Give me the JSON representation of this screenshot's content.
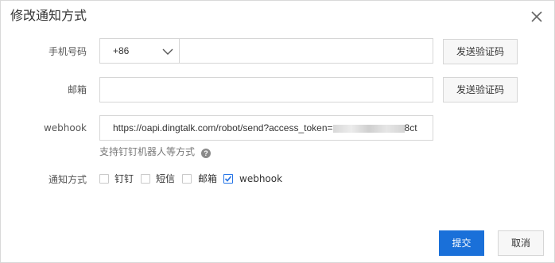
{
  "dialog": {
    "title": "修改通知方式",
    "close_icon": "close-icon"
  },
  "form": {
    "phone": {
      "label": "手机号码",
      "country_code": "+86",
      "value": "",
      "send_code_label": "发送验证码"
    },
    "email": {
      "label": "邮箱",
      "value": "",
      "send_code_label": "发送验证码"
    },
    "webhook": {
      "label": "webhook",
      "value_prefix": "https://oapi.dingtalk.com/robot/send?access_token=",
      "value_suffix": "8ct",
      "hint": "支持钉钉机器人等方式",
      "help_icon": "question-icon"
    },
    "notify_method": {
      "label": "通知方式",
      "options": [
        {
          "label": "钉钉",
          "checked": false
        },
        {
          "label": "短信",
          "checked": false
        },
        {
          "label": "邮箱",
          "checked": false
        },
        {
          "label": "webhook",
          "checked": true
        }
      ]
    }
  },
  "footer": {
    "submit_label": "提交",
    "cancel_label": "取消"
  },
  "colors": {
    "primary": "#1a70d9",
    "checkbox_checked": "#2473e6"
  }
}
